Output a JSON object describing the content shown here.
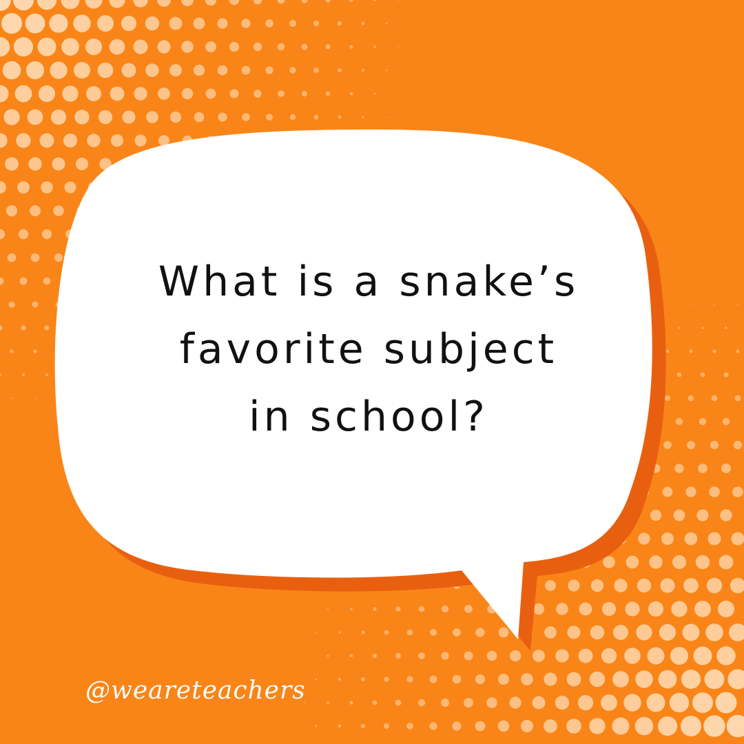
{
  "colors": {
    "background": "#f98518",
    "dots": "#ffe3c4",
    "bubble_fill": "#ffffff",
    "bubble_shadow": "#e8600f",
    "text": "#111111",
    "handle_text": "#ffffff"
  },
  "question": {
    "lines": [
      "What is a snake’s",
      "favorite subject",
      "in school?"
    ]
  },
  "footer": {
    "handle": "@weareteachers"
  }
}
